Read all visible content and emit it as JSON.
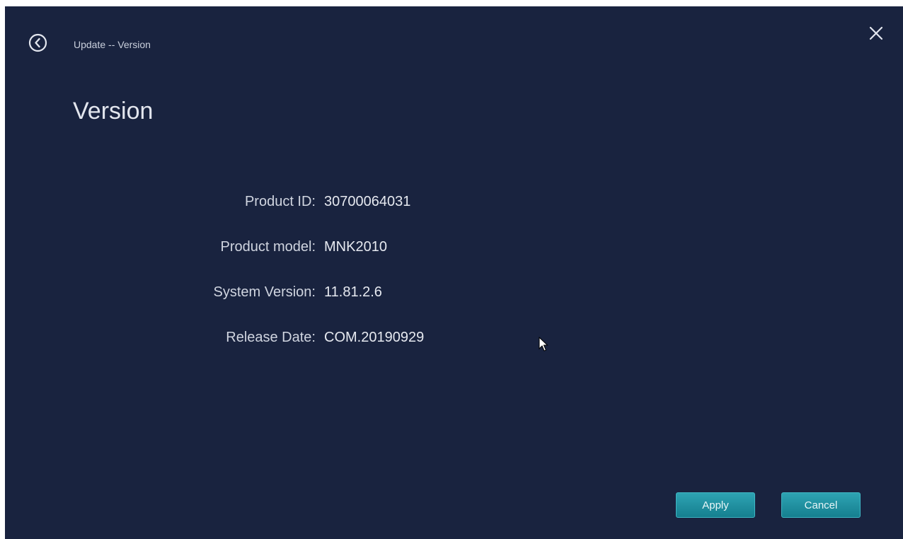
{
  "header": {
    "breadcrumb": "Update -- Version",
    "back_icon": "back-arrow-circle-icon",
    "close_icon": "close-icon"
  },
  "page": {
    "title": "Version"
  },
  "info": {
    "rows": [
      {
        "label": "Product ID:",
        "value": "30700064031"
      },
      {
        "label": "Product model:",
        "value": "MNK2010"
      },
      {
        "label": "System Version:",
        "value": "11.81.2.6"
      },
      {
        "label": "Release Date:",
        "value": "COM.20190929"
      }
    ]
  },
  "footer": {
    "apply_label": "Apply",
    "cancel_label": "Cancel"
  },
  "colors": {
    "background": "#19233f",
    "button": "#1f93a3",
    "text": "#d8dce6"
  }
}
